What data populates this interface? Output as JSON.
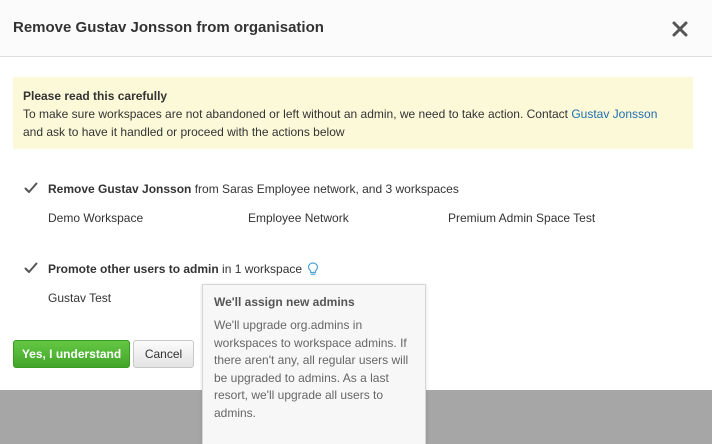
{
  "dialog": {
    "title": "Remove Gustav Jonsson from organisation"
  },
  "notice": {
    "heading": "Please read this carefully",
    "text_before_link": "To make sure workspaces are not abandoned or left without an admin, we need to take action. Contact ",
    "link": "Gustav Jonsson",
    "text_after_link": "and ask to have it handled or proceed with the actions below"
  },
  "actions": [
    {
      "bold": "Remove Gustav Jonsson",
      "rest": " from Saras Employee network, and 3 workspaces",
      "workspaces": [
        "Demo Workspace",
        "Employee Network",
        "Premium Admin Space Test"
      ]
    },
    {
      "bold": "Promote other users to admin",
      "rest": " in 1 workspace",
      "workspaces": [
        "Gustav Test"
      ]
    }
  ],
  "tooltip": {
    "title": "We'll assign new admins",
    "body": "We'll upgrade org.admins in workspaces to workspace admins. If there aren't any, all regular users will be upgraded to admins. As a last resort, we'll upgrade all users to admins."
  },
  "buttons": {
    "confirm": "Yes, I understand",
    "cancel": "Cancel"
  },
  "icons": {
    "close": "close-icon",
    "check": "check-icon",
    "hint": "lightbulb-icon"
  },
  "colors": {
    "confirm_button": "#4cb632",
    "link": "#1f6db0",
    "notice_background": "#fcf9d9",
    "hint_icon": "#4aa3d6"
  }
}
